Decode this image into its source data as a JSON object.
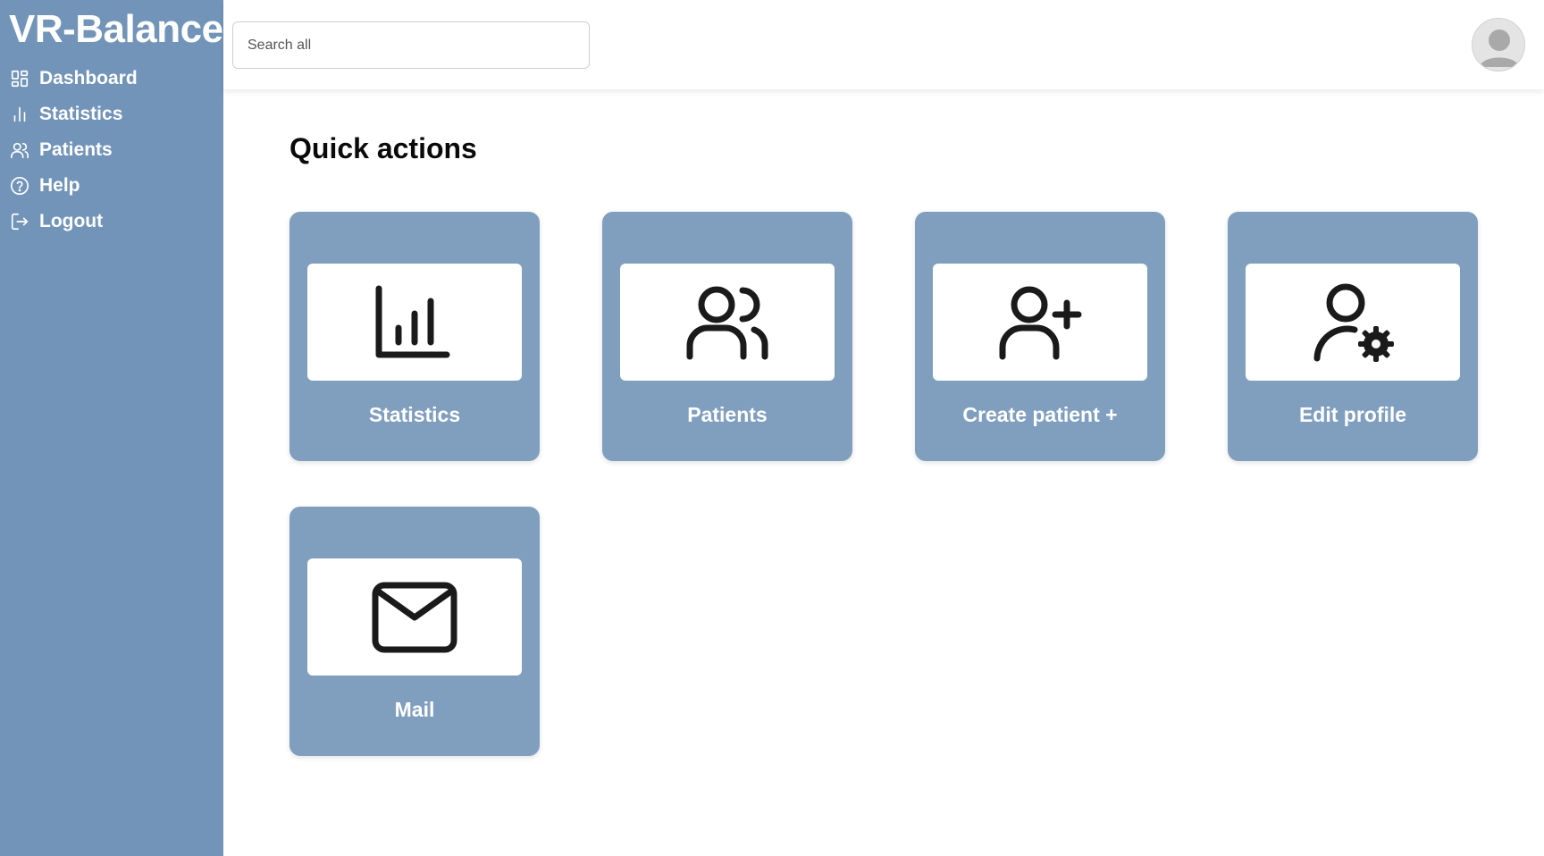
{
  "app": {
    "brand": "VR-Balance"
  },
  "sidebar": {
    "items": [
      {
        "label": "Dashboard",
        "icon": "dashboard-icon"
      },
      {
        "label": "Statistics",
        "icon": "bar-chart-icon"
      },
      {
        "label": "Patients",
        "icon": "users-icon"
      },
      {
        "label": "Help",
        "icon": "help-circle-icon"
      },
      {
        "label": "Logout",
        "icon": "logout-icon"
      }
    ]
  },
  "header": {
    "search_placeholder": "Search all",
    "search_value": "",
    "avatar_icon": "user-avatar-icon"
  },
  "main": {
    "title": "Quick actions",
    "cards": [
      {
        "label": "Statistics",
        "icon": "bar-chart-icon"
      },
      {
        "label": "Patients",
        "icon": "users-icon"
      },
      {
        "label": "Create patient +",
        "icon": "user-plus-icon"
      },
      {
        "label": "Edit profile",
        "icon": "user-settings-icon"
      },
      {
        "label": "Mail",
        "icon": "mail-icon"
      }
    ]
  },
  "colors": {
    "sidebar_bg": "#7294b8",
    "card_bg": "#809fbf",
    "text_light": "#ffffff",
    "text_dark": "#0a0a0a"
  }
}
